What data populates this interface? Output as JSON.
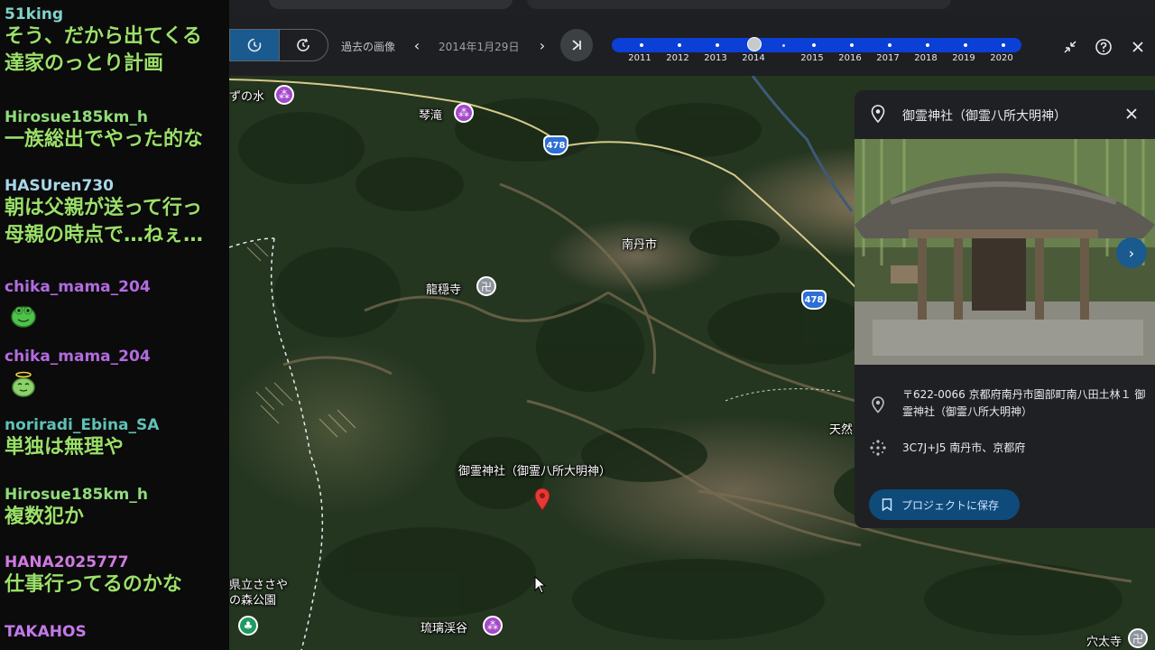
{
  "chat": {
    "messages": [
      {
        "user": "51king",
        "user_color": "#7fd3c8",
        "text": "そう、だから出てくる"
      },
      {
        "user": "",
        "user_color": "#7fd3c8",
        "text": "達家のっとり計画"
      },
      {
        "user": "Hirosue185km_h",
        "user_color": "#8fdc7a",
        "text": "一族総出でやった的な"
      },
      {
        "user": "HASUren730",
        "user_color": "#a8d8ea",
        "text": "朝は父親が送って行っ"
      },
      {
        "user": "",
        "user_color": "#a8d8ea",
        "text": "母親の時点で…ねぇ…"
      },
      {
        "user": "chika_mama_204",
        "user_color": "#b26be0",
        "text": "",
        "emote": "frog-emote"
      },
      {
        "user": "chika_mama_204",
        "user_color": "#b26be0",
        "text": "",
        "emote": "frog-angel-emote"
      },
      {
        "user": "noriradi_Ebina_SA",
        "user_color": "#5fc1b6",
        "text": "単独は無理や"
      },
      {
        "user": "Hirosue185km_h",
        "user_color": "#8fdc7a",
        "text": "複数犯か"
      },
      {
        "user": "HANA2025777",
        "user_color": "#d07ae0",
        "text": "仕事行ってるのかな"
      },
      {
        "user": "TAKAHOS",
        "user_color": "#c27ae8",
        "text": ""
      }
    ]
  },
  "timebar": {
    "past_imagery_label": "過去の画像",
    "current_date": "2014年1月29日",
    "years": [
      "2011",
      "2012",
      "2013",
      "2014",
      "2015",
      "2016",
      "2017",
      "2018",
      "2019",
      "2020"
    ],
    "selected_year": "2014"
  },
  "map": {
    "labels": {
      "zunomizu": "ずの水",
      "kotodaki": "琴滝",
      "nantan_city": "南丹市",
      "ryuonji": "龍穏寺",
      "shrine": "御霊神社（御霊八所大明神）",
      "tennen": "天然",
      "park": "県立ささや",
      "park2": "の森公園",
      "rurikeikoku": "琉璃渓谷",
      "anataji": "穴太寺"
    },
    "route_number": "478"
  },
  "card": {
    "title": "御霊神社（御霊八所大明神）",
    "address": "〒622-0066 京都府南丹市園部町南八田土林１ 御霊神社（御霊八所大明神）",
    "plus_code": "3C7J+J5 南丹市、京都府",
    "save_label": "プロジェクトに保存"
  },
  "colors": {
    "accent_blue": "#0b3fd6",
    "chat_text": "#9be06a",
    "panel_bg": "#1f2023"
  }
}
